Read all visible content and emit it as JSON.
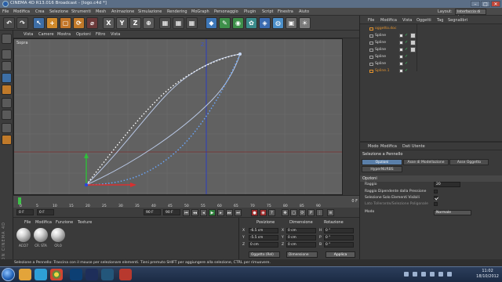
{
  "window": {
    "title": "CINEMA 4D R13.016 Broadcast - [logo.c4d *]",
    "minimize": "–",
    "maximize": "□",
    "close": "✕"
  },
  "menubar": {
    "items": [
      "File",
      "Modifica",
      "Crea",
      "Selezione",
      "Strumenti",
      "Mesh",
      "Animazione",
      "Simulazione",
      "Rendering",
      "MoGraph",
      "Personaggio",
      "Plugin",
      "Script",
      "Finestra",
      "Aiuto"
    ],
    "layout_label": "Layout:",
    "layout_value": "Interfaccia di Avvio"
  },
  "toolbar": {
    "axis_x": "X",
    "axis_y": "Y",
    "axis_z": "Z"
  },
  "viewport": {
    "menu": [
      "Vista",
      "Camere",
      "Mostra",
      "Opzioni",
      "Filtro",
      "Vista"
    ],
    "label": "Sopra",
    "axis_label": "Z"
  },
  "timeline": {
    "ticks": [
      "0",
      "5",
      "10",
      "15",
      "20",
      "25",
      "30",
      "35",
      "40",
      "45",
      "50",
      "55",
      "60",
      "65",
      "70",
      "75",
      "80",
      "85",
      "90"
    ],
    "current_frame": "0 F"
  },
  "playback": {
    "start_frame": "0 F",
    "current_frame": "0 F",
    "end_frame": "90 F",
    "end_frame2": "90 F"
  },
  "materials": {
    "menu": [
      "File",
      "Modifica",
      "Funzione",
      "Texture"
    ],
    "items": [
      "ACCI7",
      "CR. STA",
      "CR.0"
    ],
    "brand": "MAXON CINEMA 4D"
  },
  "coordinates": {
    "headers": [
      "Posizione",
      "Dimensione",
      "Rotazione"
    ],
    "rows": [
      {
        "axis": "X",
        "pos": "-6.5 cm",
        "dim_axis": "X",
        "dim": "0 cm",
        "rot_axis": "H",
        "rot": "0 °"
      },
      {
        "axis": "Y",
        "pos": "-5.5 cm",
        "dim_axis": "Y",
        "dim": "0 cm",
        "rot_axis": "P",
        "rot": "0 °"
      },
      {
        "axis": "Z",
        "pos": "0 cm",
        "dim_axis": "Z",
        "dim": "0 cm",
        "rot_axis": "B",
        "rot": "0 °"
      }
    ],
    "mode": "Oggetto (Rel)",
    "mode2": "Dimensione",
    "apply": "Applica"
  },
  "object_manager": {
    "menu": [
      "File",
      "Modifica",
      "Vista",
      "Oggetti",
      "Tag",
      "Segnalibri"
    ],
    "objects": [
      {
        "name": "oggetto.doc",
        "orange": true
      },
      {
        "name": "Spline",
        "orange": false
      },
      {
        "name": "Spline",
        "orange": false
      },
      {
        "name": "Spline",
        "orange": false
      },
      {
        "name": "Spline",
        "orange": false
      },
      {
        "name": "Spline",
        "orange": false
      },
      {
        "name": "Spline.1",
        "orange": true
      }
    ]
  },
  "attribute_manager": {
    "menu": [
      "Modo",
      "Modifica",
      "Dati Utente"
    ],
    "object_title": "Selezione a Pennello",
    "tabs": [
      "Opzioni",
      "Asse di Modellazione",
      "Asse Oggetto",
      "HyperNURBS"
    ],
    "section": "Opzioni",
    "raggio_label": "Raggio",
    "raggio_value": "20",
    "options": [
      {
        "label": "Raggio Dipendente dalla Pressione",
        "checked": false
      },
      {
        "label": "Selezione Solo Elementi Visibili",
        "checked": true
      },
      {
        "label": "Lato Tollerante/Selezione Poligonale",
        "checked": false
      }
    ],
    "modo_label": "Modo",
    "modo_value": "Normale"
  },
  "status": {
    "text": "Selezione a Pennello: Trascina con il mouse per selezionare elementi. Tieni premuto SHIFT per aggiungere alla selezione, CTRL per rimuovere."
  },
  "taskbar": {
    "time": "11:02",
    "date": "18/10/2012"
  }
}
